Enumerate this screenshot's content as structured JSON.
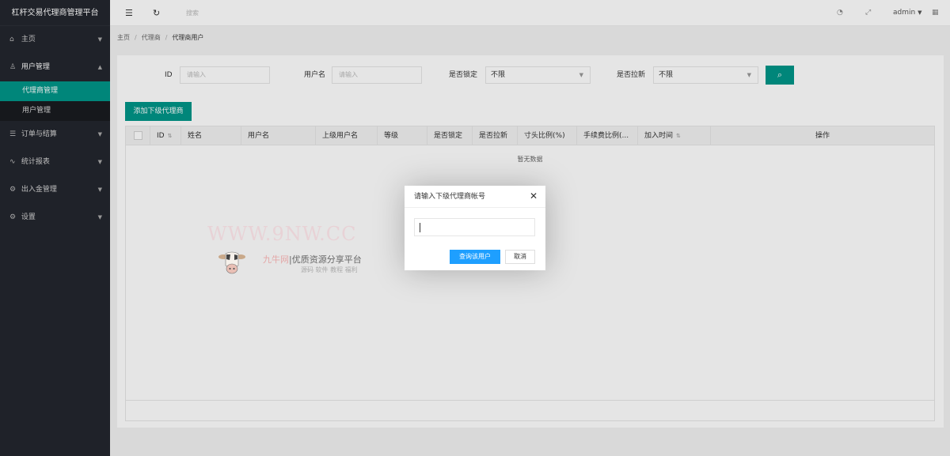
{
  "app": {
    "title": "杠杆交易代理商管理平台"
  },
  "sidebar": {
    "items": [
      {
        "label": "主页",
        "icon": "home-icon",
        "glyph": "⌂"
      },
      {
        "label": "用户管理",
        "icon": "user-icon",
        "glyph": "♙"
      },
      {
        "label": "订单与结算",
        "icon": "list-icon",
        "glyph": "☰"
      },
      {
        "label": "统计报表",
        "icon": "chart-icon",
        "glyph": "∿"
      },
      {
        "label": "出入金管理",
        "icon": "money-icon",
        "glyph": "⚙"
      },
      {
        "label": "设置",
        "icon": "gear-icon",
        "glyph": "⚙"
      }
    ],
    "sub_items": [
      {
        "label": "代理商管理",
        "active": true
      },
      {
        "label": "用户管理",
        "active": false
      }
    ]
  },
  "header": {
    "search_label": "搜索",
    "user_label": "admin"
  },
  "breadcrumb": [
    "主页",
    "代理商",
    "代理商用户"
  ],
  "filters": {
    "id_label": "ID",
    "id_placeholder": "请输入",
    "username_label": "用户名",
    "username_placeholder": "请输入",
    "locked_label": "是否锁定",
    "locked_value": "不限",
    "blacklist_label": "是否拉新",
    "blacklist_value": "不限"
  },
  "add_button_label": "添加下级代理商",
  "table": {
    "columns": [
      "ID",
      "姓名",
      "用户名",
      "上级用户名",
      "等级",
      "是否锁定",
      "是否拉新",
      "寸头比例(%)",
      "手续费比例(...",
      "加入时间",
      "操作"
    ],
    "empty_text": "暂无数据"
  },
  "watermark": {
    "url": "WWW.9NW.CC",
    "title_hi": "九牛网",
    "title": "优质资源分享平台",
    "subtitle": "源码 软件 教程 福利"
  },
  "dialog": {
    "title": "请输入下级代理商帐号",
    "ok_label": "查询该用户",
    "cancel_label": "取消"
  },
  "colors": {
    "accent": "#009688",
    "primary": "#1e9fff",
    "sidebar_bg": "#23262e"
  }
}
